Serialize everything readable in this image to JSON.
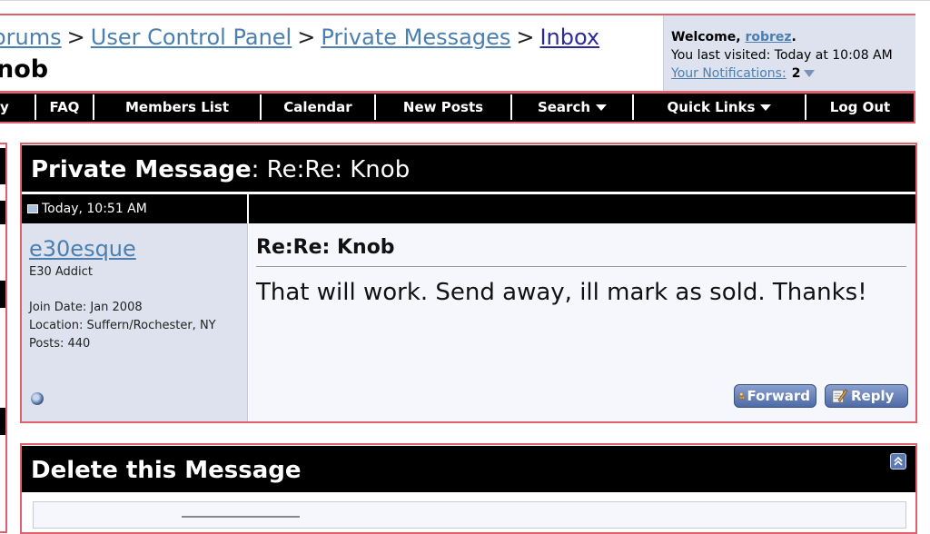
{
  "breadcrumb": {
    "items": [
      "orums",
      "User Control Panel",
      "Private Messages",
      "Inbox"
    ],
    "separator": ">"
  },
  "page_title": "nob",
  "welcome": {
    "prefix": "Welcome, ",
    "username": "robrez",
    "suffix": ".",
    "last_visited": "You last visited: Today at 10:08 AM",
    "notifications_label": "Your Notifications:",
    "notifications_count": "2"
  },
  "nav": {
    "items": [
      "y",
      "FAQ",
      "Members List",
      "Calendar",
      "New Posts",
      "Search",
      "Quick Links",
      "Log Out"
    ]
  },
  "pm": {
    "title_label": "Private Message",
    "title_subject": ": Re:Re: Knob",
    "date": "Today, 10:51 AM",
    "user": {
      "name": "e30esque",
      "title": "E30 Addict",
      "join_date": "Join Date: Jan 2008",
      "location": "Location: Suffern/Rochester, NY",
      "posts": "Posts: 440"
    },
    "subject": "Re:Re: Knob",
    "body": "That will work. Send away, ill mark as sold. Thanks!",
    "forward_label": "Forward",
    "reply_label": "Reply"
  },
  "delete_box": {
    "title": "Delete this Message"
  },
  "colors": {
    "frame_border": "#e0606c",
    "link": "#4a7fb0",
    "panel_bg": "#dde2ee",
    "bar_bg": "#000000"
  }
}
